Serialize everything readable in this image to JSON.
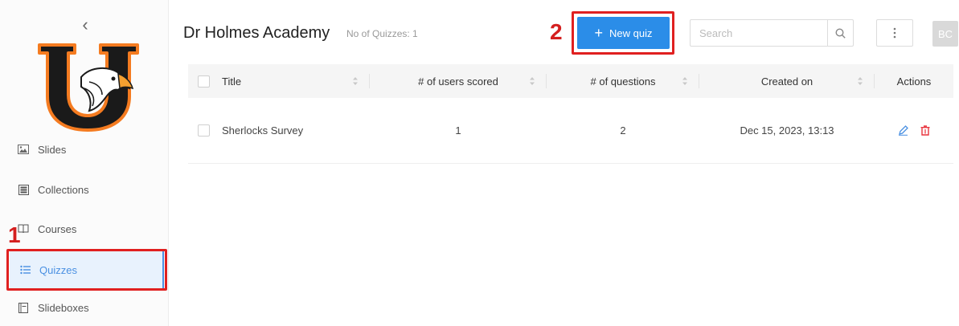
{
  "sidebar": {
    "items": [
      {
        "label": "Slides",
        "icon": "image-icon"
      },
      {
        "label": "Collections",
        "icon": "collections-icon"
      },
      {
        "label": "Courses",
        "icon": "book-icon"
      },
      {
        "label": "Quizzes",
        "icon": "list-icon"
      },
      {
        "label": "Slideboxes",
        "icon": "slidebox-icon"
      }
    ],
    "active_item": "Quizzes"
  },
  "annotations": {
    "step1": "1",
    "step2": "2"
  },
  "header": {
    "title": "Dr Holmes Academy",
    "quiz_count": "No of Quizzes: 1",
    "new_quiz_label": "New quiz",
    "search_placeholder": "Search",
    "avatar_initials": "BC"
  },
  "table": {
    "columns": [
      "Title",
      "# of users scored",
      "# of questions",
      "Created on",
      "Actions"
    ],
    "rows": [
      {
        "title": "Sherlocks Survey",
        "users_scored": "1",
        "questions": "2",
        "created_on": "Dec 15, 2023, 13:13"
      }
    ]
  },
  "colors": {
    "accent": "#2b8de8",
    "highlight": "#e02020",
    "logo_orange": "#f47b20",
    "delete": "#e8333d"
  }
}
